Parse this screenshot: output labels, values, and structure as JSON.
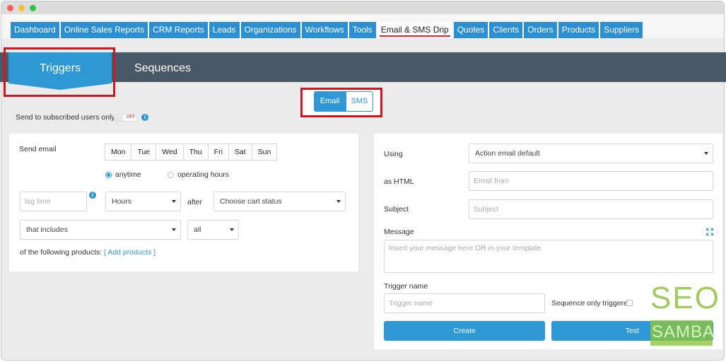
{
  "nav": {
    "tabs": [
      {
        "label": "Dashboard"
      },
      {
        "label": "Online Sales Reports"
      },
      {
        "label": "CRM Reports"
      },
      {
        "label": "Leads"
      },
      {
        "label": "Organizations"
      },
      {
        "label": "Workflows"
      },
      {
        "label": "Tools"
      },
      {
        "label": "Email & SMS Drip",
        "active": true
      },
      {
        "label": "Quotes"
      },
      {
        "label": "Clients"
      },
      {
        "label": "Orders"
      },
      {
        "label": "Products"
      },
      {
        "label": "Suppliers"
      }
    ]
  },
  "subnav": {
    "triggers": "Triggers",
    "sequences": "Sequences"
  },
  "channel": {
    "email": "Email",
    "sms": "SMS",
    "selected": "Email"
  },
  "subscribed": {
    "label": "Send to subscribed users only",
    "switch_state": "OFF"
  },
  "left": {
    "send_email_label": "Send email",
    "days": [
      "Mon",
      "Tue",
      "Wed",
      "Thu",
      "Fri",
      "Sat",
      "Sun"
    ],
    "anytime": "anytime",
    "operating_hours": "operating hours",
    "lag_placeholder": "lag time",
    "hours_select": "Hours",
    "after_label": "after",
    "cart_status_select": "Choose cart status",
    "includes_select": "that includes",
    "all_select": "all",
    "products_label": "of the following products:",
    "add_products": "[ Add products ]"
  },
  "right": {
    "using_label": "Using",
    "using_select": "Action email default",
    "html_label": "as HTML",
    "email_from_placeholder": "Email from",
    "subject_label": "Subject",
    "subject_placeholder": "Subject",
    "message_label": "Message",
    "message_placeholder": "Insert your message here OR in your template",
    "trigger_name_label": "Trigger name",
    "trigger_name_placeholder": "Trigger name",
    "sequence_only_label": "Sequence only triggered",
    "create_button": "Create",
    "test_button": "Test"
  },
  "watermark": {
    "line1": "SEO",
    "line2": "SAMBA"
  },
  "colors": {
    "accent": "#2e98d4",
    "header": "#485a68",
    "highlight": "#d3141c",
    "watermark": "#8dc43f"
  }
}
